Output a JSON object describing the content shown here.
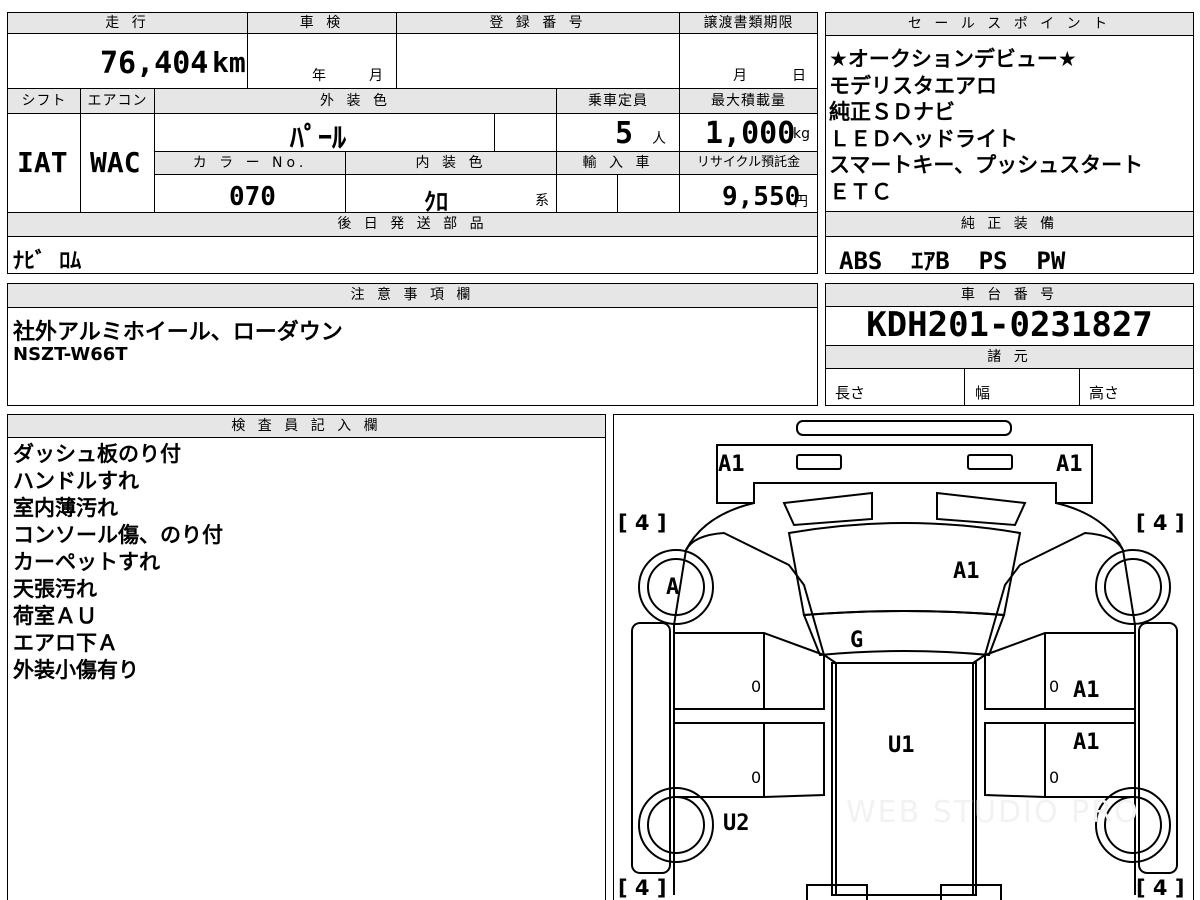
{
  "headers": {
    "mileage": "走 行",
    "inspection": "車 検",
    "registration": "登 録 番 号",
    "transfer_deadline": "譲渡書類期限",
    "sales_points": "セ ー ル ス ポ イ ン ト",
    "shift": "シフト",
    "aircon": "エアコン",
    "exterior_color": "外 装 色",
    "capacity": "乗車定員",
    "max_load": "最大積載量",
    "color_no": "カ ラ ー No.",
    "interior_color": "内 装 色",
    "import": "輸 入 車",
    "recycle": "リサイクル預託金",
    "later_parts": "後 日 発 送 部 品",
    "genuine_equipment": "純 正 装 備",
    "notes": "注 意 事 項 欄",
    "chassis_number": "車 台 番 号",
    "specs": "諸 元",
    "inspector": "検 査 員 記 入 欄"
  },
  "vehicle": {
    "mileage": "76,404",
    "mileage_unit": "km",
    "inspection_year": "年",
    "inspection_month": "月",
    "deadline_month": "月",
    "deadline_day": "日",
    "shift": "IAT",
    "aircon": "WAC",
    "exterior_color": "ﾊﾟｰﾙ",
    "capacity": "5",
    "capacity_unit": "人",
    "max_load": "1,000",
    "max_load_unit": "kg",
    "color_no": "070",
    "interior_color": "ｸﾛ",
    "interior_suffix": "系",
    "recycle_fee": "9,550",
    "recycle_unit": "円",
    "later_parts": "ﾅﾋﾞ ﾛﾑ",
    "genuine_equipment": "ABS  ｴｱB  PS  PW",
    "chassis_number": "KDH201-0231827",
    "spec_length": "長さ",
    "spec_width": "幅",
    "spec_height": "高さ"
  },
  "sales_points": [
    "★オークションデビュー★",
    "モデリスタエアロ",
    "純正ＳＤナビ",
    "ＬＥＤヘッドライト",
    "スマートキー、プッシュスタート",
    "ＥＴＣ"
  ],
  "notes": [
    "社外アルミホイール、ローダウン",
    "NSZT-W66T"
  ],
  "inspector_notes": [
    "ダッシュ板のり付",
    "ハンドルすれ",
    "室内薄汚れ",
    "コンソール傷、のり付",
    "カーペットすれ",
    "天張汚れ",
    "荷室ＡＵ",
    "エアロ下Ａ",
    "外装小傷有り"
  ],
  "diagram": {
    "marks": {
      "front_left": "A1",
      "front_right": "A1",
      "front_left_tire": "A",
      "hood": "A1",
      "windshield": "G",
      "right_front_door": "A1",
      "right_rear_door": "A1",
      "roof": "U1",
      "left_rear_wheel_area": "U2"
    },
    "tire_tread_labels": [
      "[ 4 ]",
      "[ 4 ]",
      "[ 4 ]",
      "[ 4 ]"
    ],
    "door_zeros": [
      "0",
      "0",
      "0",
      "0"
    ],
    "watermark": "WEB STUDIO PRO"
  }
}
